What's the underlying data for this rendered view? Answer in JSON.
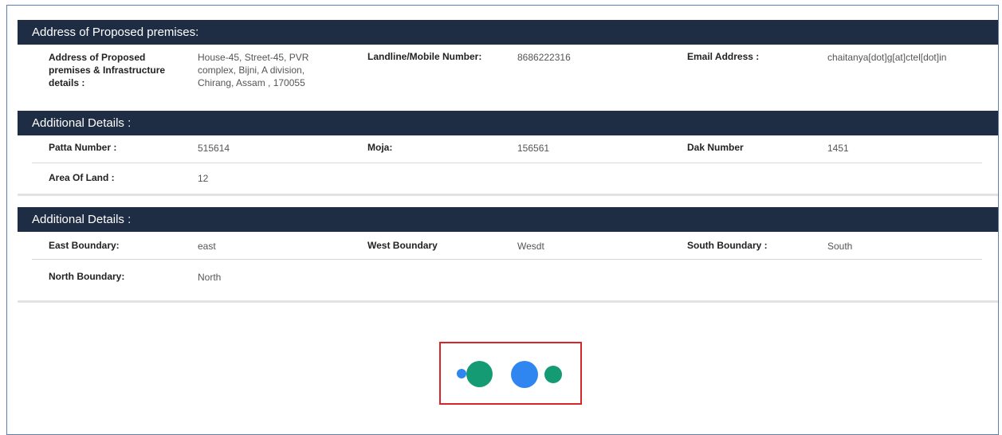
{
  "sections": [
    {
      "title": "Address of Proposed premises:",
      "fields": [
        {
          "label": "Address of Proposed premises & Infrastructure details :",
          "value": "House-45, Street-45, PVR complex, Bijni, A division, Chirang, Assam , 170055"
        },
        {
          "label": "Landline/Mobile Number:",
          "value": "8686222316"
        },
        {
          "label": "Email Address :",
          "value": "chaitanya[dot]g[at]ctel[dot]in"
        }
      ]
    },
    {
      "title": "Additional Details :",
      "fields": [
        {
          "label": "Patta Number :",
          "value": "515614"
        },
        {
          "label": "Moja:",
          "value": "156561"
        },
        {
          "label": "Dak Number",
          "value": "1451"
        },
        {
          "label": "Area Of Land :",
          "value": "12"
        }
      ]
    },
    {
      "title": "Additional Details :",
      "fields": [
        {
          "label": "East Boundary:",
          "value": "east"
        },
        {
          "label": "West Boundary",
          "value": "Wesdt"
        },
        {
          "label": "South Boundary :",
          "value": "South"
        },
        {
          "label": "North Boundary:",
          "value": "North"
        }
      ]
    }
  ],
  "loader": {
    "icon": "loading-dots-icon",
    "colors": {
      "blue": "#2f86f0",
      "green": "#159b73"
    }
  },
  "theme": {
    "header_bg": "#1f2d44",
    "header_text": "#ffffff",
    "highlight_border": "#d9242c"
  }
}
